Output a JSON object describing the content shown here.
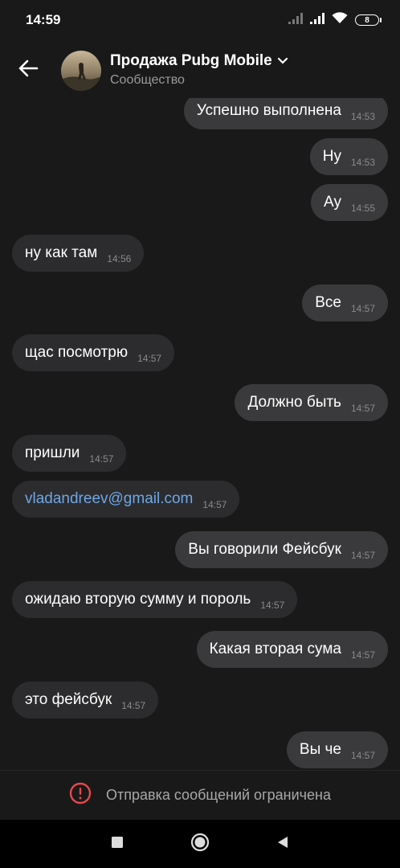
{
  "status_bar": {
    "time": "14:59",
    "battery": "8"
  },
  "header": {
    "back_icon": "arrow-left-icon",
    "title": "Продажа Pubg Mobile",
    "subtitle": "Сообщество",
    "dropdown_icon": "chevron-down-icon"
  },
  "messages": [
    {
      "text": "Успешно выполнена",
      "time": "14:53",
      "direction": "out"
    },
    {
      "text": "Ну",
      "time": "14:53",
      "direction": "out"
    },
    {
      "text": "Ау",
      "time": "14:55",
      "direction": "out"
    },
    {
      "text": "ну как там",
      "time": "14:56",
      "direction": "in"
    },
    {
      "text": "Все",
      "time": "14:57",
      "direction": "out"
    },
    {
      "text": "щас посмотрю",
      "time": "14:57",
      "direction": "in"
    },
    {
      "text": "Должно быть",
      "time": "14:57",
      "direction": "out"
    },
    {
      "text": "пришли",
      "time": "14:57",
      "direction": "in"
    },
    {
      "text": "vladandreev@gmail.com",
      "time": "14:57",
      "direction": "in",
      "link": true
    },
    {
      "text": "Вы говорили Фейсбук",
      "time": "14:57",
      "direction": "out"
    },
    {
      "text": "ожидаю вторую сумму и пороль",
      "time": "14:57",
      "direction": "in"
    },
    {
      "text": "Какая вторая сума",
      "time": "14:57",
      "direction": "out"
    },
    {
      "text": "это фейсбук",
      "time": "14:57",
      "direction": "in"
    },
    {
      "text": "Вы че",
      "time": "14:57",
      "direction": "out"
    }
  ],
  "restriction": {
    "icon": "alert-circle-icon",
    "text": "Отправка сообщений ограничена",
    "color": "#e5484d"
  },
  "nav": {
    "recents_icon": "square-icon",
    "home_icon": "circle-icon",
    "back_icon": "triangle-back-icon"
  },
  "colors": {
    "background": "#191919",
    "bubble_in": "#2c2c2e",
    "bubble_out": "#3a3a3c",
    "link": "#6ea6e6"
  }
}
